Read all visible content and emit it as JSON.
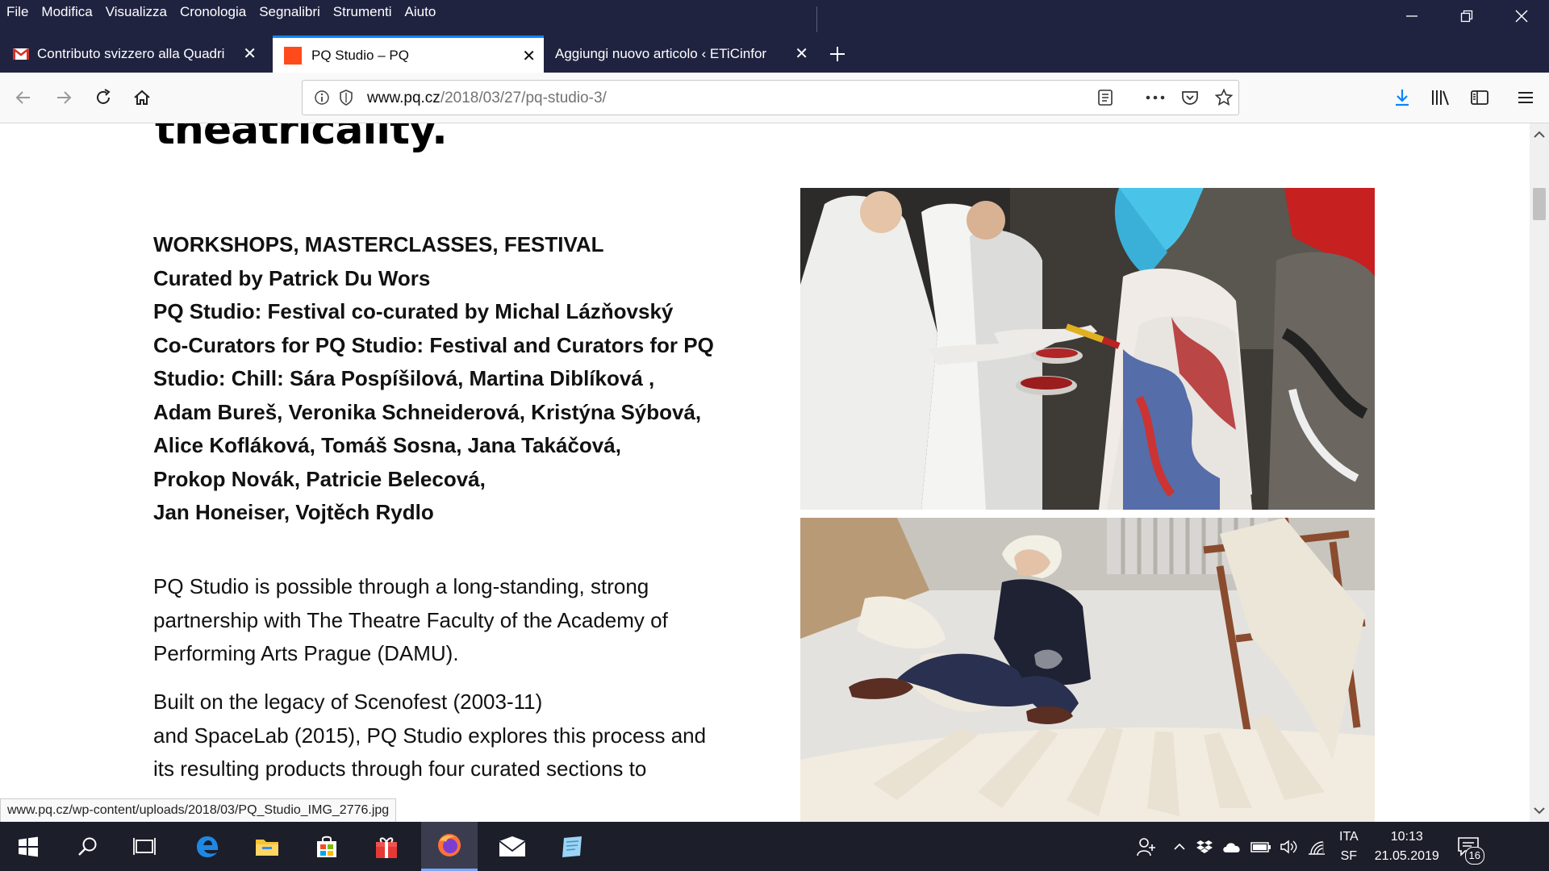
{
  "menu": [
    "File",
    "Modifica",
    "Visualizza",
    "Cronologia",
    "Segnalibri",
    "Strumenti",
    "Aiuto"
  ],
  "tabs": [
    {
      "label": "Contributo svizzero alla Quadri",
      "icon": "gmail-icon",
      "active": false
    },
    {
      "label": "PQ Studio – PQ",
      "icon": "pq-favicon",
      "active": true
    },
    {
      "label": "Aggiungi nuovo articolo ‹ ETiCinfor",
      "icon": "",
      "active": false
    }
  ],
  "url": {
    "host": "www.pq.cz",
    "path": "/2018/03/27/pq-studio-3/"
  },
  "page": {
    "headline": "theatricality.",
    "credits": [
      "WORKSHOPS, MASTERCLASSES, FESTIVAL",
      "Curated by Patrick Du Wors",
      "PQ Studio: Festival co-curated by Michal Lázňovský",
      "Co-Curators for PQ Studio: Festival and Curators for PQ",
      "Studio: Chill: Sára Pospíšilová, Martina Diblíková ,",
      "Adam Bureš, Veronika Schneiderová, Kristýna Sýbová,",
      "Alice Kofláková, Tomáš Sosna, Jana Takáčová,",
      "Prokop Novák, Patricie Belecová,",
      "Jan Honeiser, Vojtěch Rydlo"
    ],
    "para1": [
      "PQ Studio is possible through a long-standing, strong",
      "partnership with The Theatre Faculty of the Academy of",
      "Performing Arts Prague (DAMU)."
    ],
    "para2": [
      "Built on the legacy of Scenofest (2003-11)",
      "and SpaceLab (2015), PQ Studio explores this process and",
      "its resulting products through four curated sections to"
    ]
  },
  "status_url": "www.pq.cz/wp-content/uploads/2018/03/PQ_Studio_IMG_2776.jpg",
  "tray": {
    "lang": "ITA",
    "layout": "SF",
    "time": "10:13",
    "date": "21.05.2019",
    "notifications": "16"
  },
  "colors": {
    "titlebar": "#202340",
    "accent": "#0a84ff",
    "taskbar": "#1c1e2a"
  }
}
